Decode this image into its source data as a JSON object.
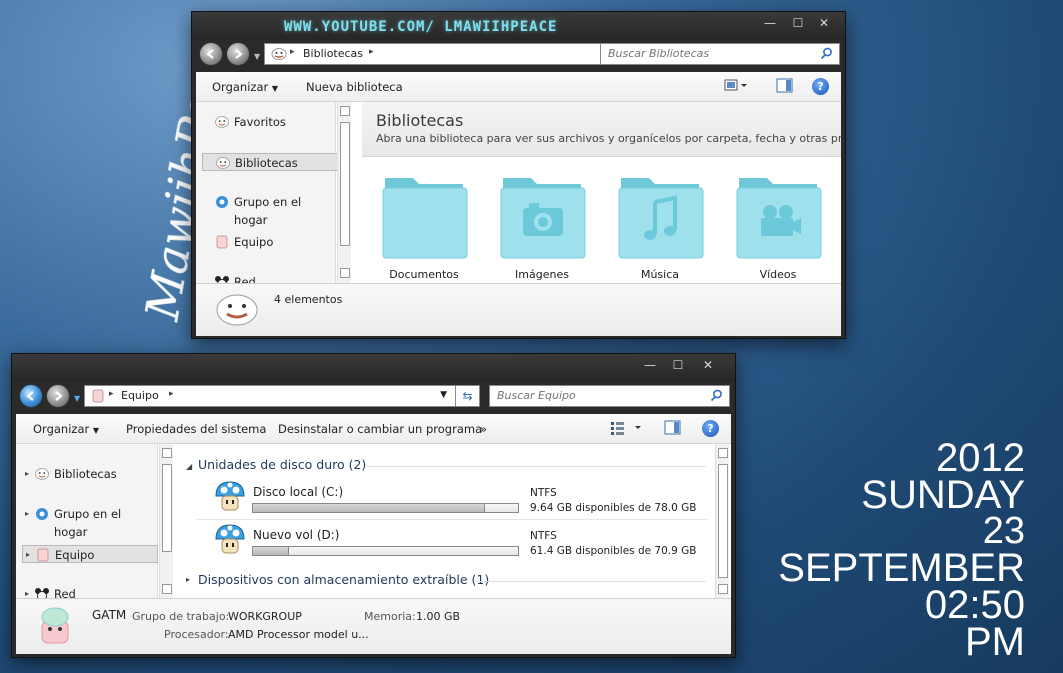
{
  "desktop": {
    "signature": "MawiihPeace",
    "clock": {
      "year": "2012",
      "weekday": "SUNDAY",
      "day": "23",
      "month": "SEPTEMBER",
      "time": "02:50",
      "ampm": "PM"
    }
  },
  "libraries_window": {
    "title": "WWW.YOUTUBE.COM/ LMAWIIHPEACE",
    "controls": {
      "minimize": "—",
      "maximize": "☐",
      "close": "✕"
    },
    "breadcrumb": [
      "Bibliotecas"
    ],
    "search_placeholder": "Buscar Bibliotecas",
    "toolbar": {
      "organize": "Organizar",
      "new_library": "Nueva biblioteca"
    },
    "nav": [
      {
        "label": "Favoritos",
        "icon": "star-icon"
      },
      {
        "label": "Bibliotecas",
        "icon": "library-icon",
        "selected": true
      },
      {
        "label": "Grupo en el hogar",
        "icon": "homegroup-icon"
      },
      {
        "label": "Equipo",
        "icon": "computer-icon"
      },
      {
        "label": "Red",
        "icon": "network-icon"
      }
    ],
    "header": {
      "title": "Bibliotecas",
      "subtitle": "Abra una biblioteca para ver sus archivos y organícelos por carpeta, fecha y otras pr..."
    },
    "folders": [
      {
        "label": "Documentos",
        "icon": "documents-folder-icon"
      },
      {
        "label": "Imágenes",
        "icon": "pictures-folder-icon"
      },
      {
        "label": "Música",
        "icon": "music-folder-icon"
      },
      {
        "label": "Vídeos",
        "icon": "videos-folder-icon"
      }
    ],
    "details": {
      "count": "4 elementos"
    }
  },
  "computer_window": {
    "controls": {
      "minimize": "—",
      "maximize": "☐",
      "close": "✕"
    },
    "breadcrumb": [
      "Equipo"
    ],
    "search_placeholder": "Buscar Equipo",
    "toolbar": {
      "organize": "Organizar",
      "system_properties": "Propiedades del sistema",
      "uninstall": "Desinstalar o cambiar un programa",
      "more": "»"
    },
    "nav": [
      {
        "label": "Bibliotecas",
        "icon": "library-icon"
      },
      {
        "label": "Grupo en el hogar",
        "icon": "homegroup-icon"
      },
      {
        "label": "Equipo",
        "icon": "computer-icon",
        "selected": true
      },
      {
        "label": "Red",
        "icon": "network-icon"
      }
    ],
    "groups": {
      "hard_drives": "Unidades de disco duro (2)",
      "removable": "Dispositivos con almacenamiento extraíble (1)"
    },
    "drives": [
      {
        "name": "Disco local (C:)",
        "fs": "NTFS",
        "free": "9.64 GB disponibles de 78.0 GB",
        "used_fraction": 0.876
      },
      {
        "name": "Nuevo vol (D:)",
        "fs": "NTFS",
        "free": "61.4 GB disponibles de 70.9 GB",
        "used_fraction": 0.134
      }
    ],
    "details": {
      "name": "GATM",
      "workgroup_label": "Grupo de trabajo:",
      "workgroup": "WORKGROUP",
      "memory_label": "Memoria:",
      "memory": "1.00 GB",
      "processor_label": "Procesador:",
      "processor": "AMD Processor model u..."
    }
  },
  "colors": {
    "title_text": "#7ee0ee",
    "folder": "#8fdce8",
    "accent_blue": "#2f6fc0"
  }
}
